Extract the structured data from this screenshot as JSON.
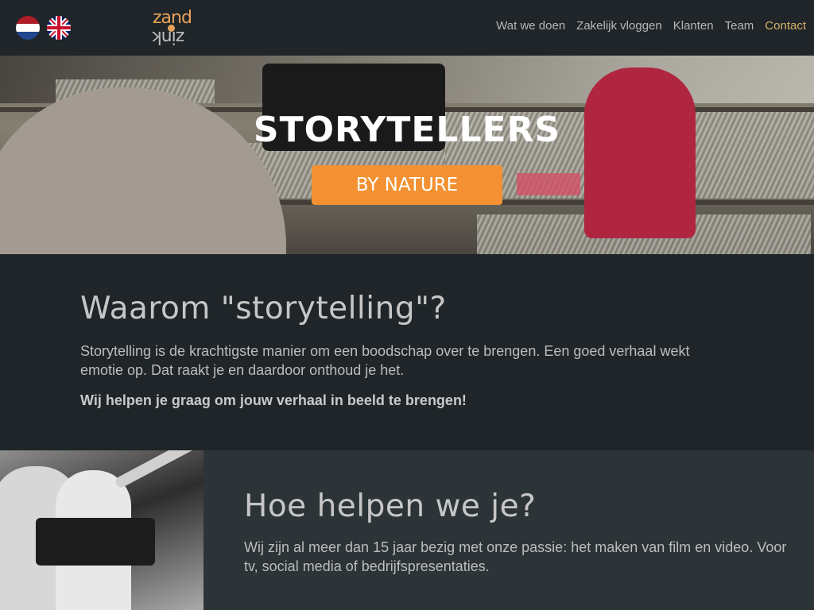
{
  "header": {
    "languages": [
      {
        "code": "nl",
        "icon": "netherlands-flag-icon"
      },
      {
        "code": "en",
        "icon": "uk-flag-icon"
      }
    ],
    "logo": {
      "top": "zand",
      "bottom": "zink",
      "icon": "zand-zink-logo"
    },
    "nav": {
      "items": [
        {
          "label": "Wat we doen"
        },
        {
          "label": "Zakelijk vloggen"
        },
        {
          "label": "Klanten"
        },
        {
          "label": "Team"
        },
        {
          "label": "Contact",
          "active": true
        }
      ]
    }
  },
  "hero": {
    "title": "STORYTELLERS",
    "button": "BY NATURE"
  },
  "section_why": {
    "heading": "Waarom \"storytelling\"?",
    "paragraph": "Storytelling is de krachtigste manier om een boodschap over te brengen. Een goed verhaal wekt emotie op. Dat raakt je en daardoor onthoud je het.",
    "emphasis": "Wij helpen je graag om jouw verhaal in beeld te brengen!"
  },
  "section_how": {
    "heading": "Hoe helpen we je?",
    "paragraph": "Wij zijn al meer dan 15 jaar bezig met onze passie: het maken van film en video. Voor tv, social media of bedrijfspresentaties."
  },
  "colors": {
    "background": "#1f2528",
    "section_alt": "#2d3438",
    "accent": "#f39133",
    "nav_active": "#d7b16a"
  }
}
